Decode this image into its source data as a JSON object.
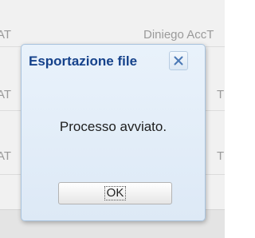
{
  "background": {
    "header_left": "AT",
    "header_right": "Diniego AccT",
    "row_left": "AT",
    "row_right": "T"
  },
  "dialog": {
    "title": "Esportazione file",
    "message": "Processo avviato.",
    "ok_label": "OK",
    "close_icon": "close-x-icon"
  },
  "colors": {
    "title": "#15428b",
    "dialog_bg": "#dde9f6",
    "dialog_border": "#a9c3dd",
    "close_glyph": "#4a78b5"
  }
}
